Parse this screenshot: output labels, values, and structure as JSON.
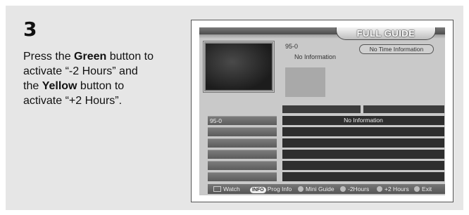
{
  "step": {
    "number": "3",
    "line1_prefix": "Press the ",
    "line1_bold": "Green",
    "line1_suffix": " button to",
    "line2": "activate “-2 Hours” and",
    "line3_prefix": "the ",
    "line3_bold": "Yellow",
    "line3_suffix": " button to",
    "line4": "activate “+2 Hours”."
  },
  "guide": {
    "title": "FULL GUIDE",
    "channel": "95-0",
    "info": "No Information",
    "time_info": "No Time Information",
    "rows": [
      {
        "channel": "95-0",
        "program": "No Information"
      },
      {
        "channel": "",
        "program": ""
      },
      {
        "channel": "",
        "program": ""
      },
      {
        "channel": "",
        "program": ""
      },
      {
        "channel": "",
        "program": ""
      },
      {
        "channel": "",
        "program": ""
      }
    ],
    "footer": {
      "watch": "Watch",
      "info_pill": "INFO",
      "prog_info": "Prog Info",
      "mini_guide": "Mini Guide",
      "minus_hours": "-2Hours",
      "plus_hours": "+2 Hours",
      "exit": "Exit"
    }
  },
  "colors": {
    "panel_bg": "#e6e6e6",
    "guide_bg": "#c9c9c9",
    "program_cell": "#2e2e2e",
    "channel_cell": "#6b6b6b"
  }
}
